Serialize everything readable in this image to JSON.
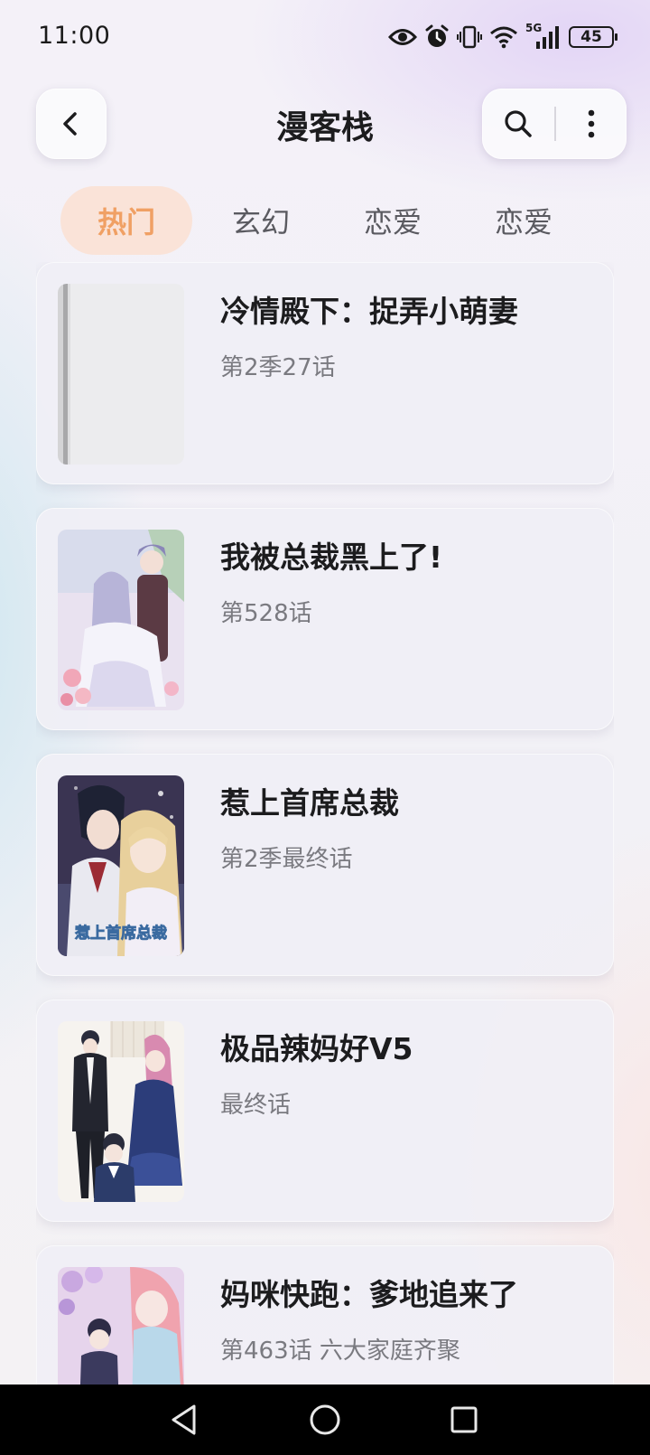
{
  "status_bar": {
    "time": "11:00",
    "icons": [
      "eye-icon",
      "alarm-icon",
      "vibrate-icon",
      "wifi-icon",
      "signal-5g-icon"
    ],
    "network_label": "5G",
    "battery": "45"
  },
  "header": {
    "title": "漫客栈",
    "icons": [
      "chevron-left-icon",
      "search-icon",
      "more-vertical-icon"
    ]
  },
  "tabs": [
    {
      "label": "热门",
      "active": true
    },
    {
      "label": "玄幻",
      "active": false
    },
    {
      "label": "恋爱",
      "active": false
    },
    {
      "label": "恋爱",
      "active": false
    }
  ],
  "comics": [
    {
      "title": "冷情殿下：捉弄小萌妻",
      "episode": "第2季27话"
    },
    {
      "title": "我被总裁黑上了!",
      "episode": "第528话"
    },
    {
      "title": "惹上首席总裁",
      "episode": "第2季最终话"
    },
    {
      "title": "极品辣妈好V5",
      "episode": "最终话"
    },
    {
      "title": "妈咪快跑：爹地追来了",
      "episode": "第463话 六大家庭齐聚"
    }
  ],
  "cover_text": {
    "comic_3": "惹上首席总裁"
  },
  "colors": {
    "active_tab_text": "#f0a064",
    "active_tab_bg": "#fae1d2"
  },
  "nav_bar": {
    "icons": [
      "back-triangle-icon",
      "home-circle-icon",
      "recents-square-icon"
    ]
  }
}
